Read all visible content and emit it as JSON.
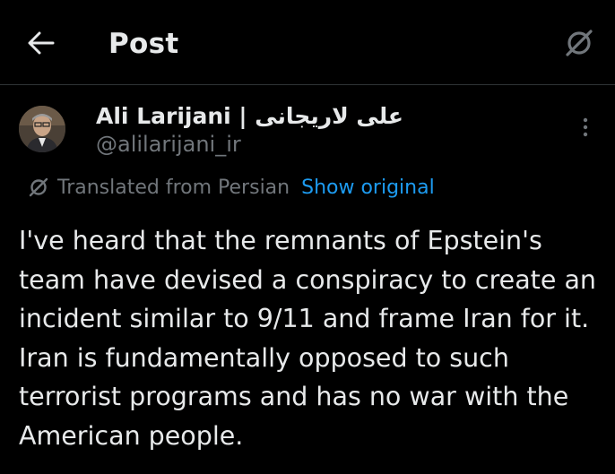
{
  "header": {
    "title": "Post",
    "back_icon": "arrow-left-icon",
    "grok_icon": "grok-icon"
  },
  "author": {
    "display_name": "Ali Larijani | علی لاریجانی",
    "handle": "@alilarijani_ir",
    "more_icon": "more-vertical-icon"
  },
  "translation": {
    "label": "Translated from Persian",
    "action": "Show original",
    "icon": "grok-icon"
  },
  "post": {
    "text": "I've heard that the remnants of Epstein's team have devised a conspiracy to create an incident similar to 9/11 and frame Iran for it. Iran is fundamentally opposed to such terrorist programs and has no war with the American people."
  },
  "colors": {
    "background": "#000000",
    "text": "#e7e9ea",
    "muted": "#71767b",
    "link": "#1d9bf0",
    "divider": "#2f3336"
  }
}
